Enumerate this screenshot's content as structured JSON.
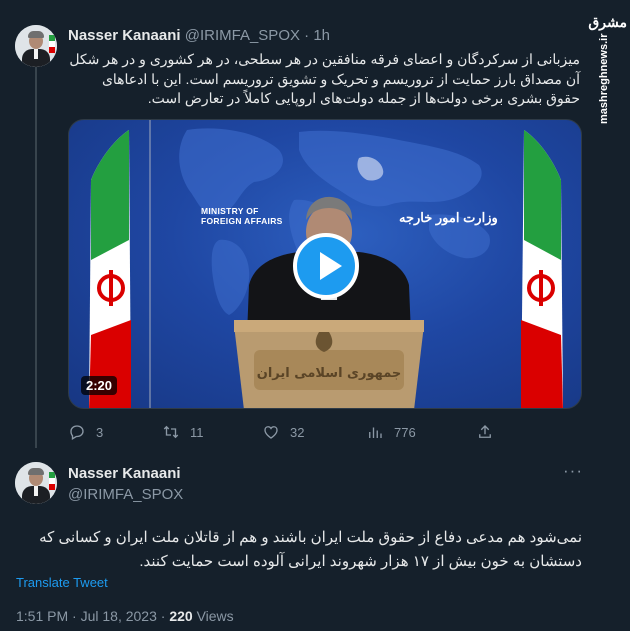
{
  "watermark": {
    "logo_text": "مشرق",
    "url": "mashreghnews.ir"
  },
  "tweet1": {
    "author_name": "Nasser Kanaani",
    "handle": "@IRIMFA_SPOX",
    "separator": "·",
    "time": "1h",
    "text": "میزبانی از سرکردگان و اعضای فرقه منافقین در هر سطحی، در هر کشوری و در هر شکل آن مصداق بارز حمایت از تروریسم و تحریک و تشویق تروریسم است. این با ادعاهای حقوق بشری برخی دولت‌ها از جمله دولت‌های اروپایی کاملاً در تعارض است.",
    "media": {
      "duration": "2:20",
      "sign_en_line1": "MINISTRY OF",
      "sign_en_line2": "FOREIGN AFFAIRS",
      "sign_fa": "وزارت امور خارجه"
    },
    "actions": {
      "replies": "3",
      "retweets": "11",
      "likes": "32",
      "views": "776"
    }
  },
  "tweet2": {
    "author_name": "Nasser Kanaani",
    "handle": "@IRIMFA_SPOX",
    "more_label": "···",
    "text": "نمی‌شود هم مدعی دفاع از حقوق ملت ایران باشند و هم از قاتلان ملت ایران و کسانی که دستشان به خون بیش از ۱۷ هزار شهروند ایرانی آلوده است حمایت کنند.",
    "translate_label": "Translate Tweet",
    "timestamp": "1:51 PM · Jul 18, 2023 ·",
    "views_count": "220",
    "views_label": "Views"
  },
  "colors": {
    "background": "#15202b",
    "text_primary": "#e7e9ea",
    "text_secondary": "#8b98a5",
    "accent": "#1d9bf0"
  },
  "icons": [
    "reply-icon",
    "retweet-icon",
    "like-icon",
    "views-icon",
    "share-icon",
    "play-icon",
    "more-icon"
  ]
}
